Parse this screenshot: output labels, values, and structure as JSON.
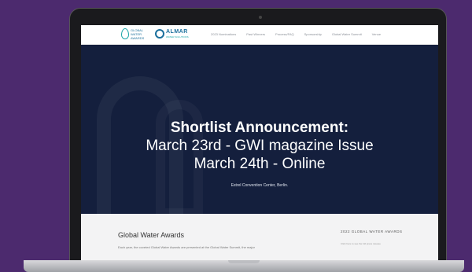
{
  "header": {
    "logo_gwa_text": "GLOBAL\nWATER\nAWARDS",
    "logo_almar_text": "ALMAR",
    "logo_almar_sub": "WATER SOLUTIONS",
    "nav_items": [
      "2023 Nominations",
      "Past Winners",
      "Process/FAQ",
      "Sponsorship",
      "Global Water Summit",
      "Venue"
    ]
  },
  "hero": {
    "title": "Shortlist Announcement:",
    "line1": "March 23rd - GWI magazine Issue",
    "line2": "March 24th - Online",
    "venue": "Estrel Convention Center, Berlin."
  },
  "content": {
    "heading": "Global Water Awards",
    "text": "Each year, the coveted Global Water Awards are presented at the Global Water Summit, the major",
    "side_heading": "2022 GLOBAL WATER AWARDS",
    "side_text": "Click here to see the full press release"
  },
  "colors": {
    "background": "#4c2a6e",
    "hero_bg": "#141f3d",
    "brand_teal": "#1aa6a8",
    "brand_blue": "#1b6f9c"
  }
}
